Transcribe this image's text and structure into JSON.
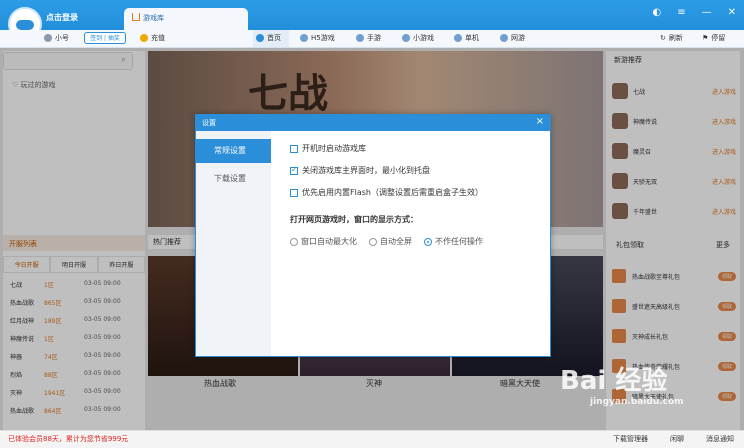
{
  "app": {
    "login": "点击登录",
    "tab": "游戏库"
  },
  "toolbar": {
    "user": "小号",
    "sign": "签到 | 抽奖",
    "recharge": "充值",
    "nav": [
      "首页",
      "H5游戏",
      "手游",
      "小游戏",
      "单机",
      "网游"
    ],
    "refresh": "刷新",
    "pin": "停留"
  },
  "left": {
    "played": "玩过的游戏",
    "open_title": "开服列表",
    "open_tabs": [
      "今日开服",
      "明日开服",
      "昨日开服"
    ],
    "rows": [
      {
        "n": "七战",
        "s": "1区",
        "t": "03-05 09:00"
      },
      {
        "n": "热血战歌",
        "s": "865区",
        "t": "03-05 09:00"
      },
      {
        "n": "红月战神",
        "s": "189区",
        "t": "03-05 09:00"
      },
      {
        "n": "神魔传说",
        "s": "1区",
        "t": "03-05 09:00"
      },
      {
        "n": "神器",
        "s": "74区",
        "t": "03-05 09:00"
      },
      {
        "n": "烈焰",
        "s": "88区",
        "t": "03-05 09:00"
      },
      {
        "n": "灭神",
        "s": "1941区",
        "t": "03-05 09:00"
      },
      {
        "n": "热血战歌",
        "s": "864区",
        "t": "03-05 09:00"
      }
    ]
  },
  "center": {
    "hot_title": "热门推荐",
    "captions": [
      "热血战歌",
      "灭神",
      "暗黑大天使"
    ]
  },
  "right": {
    "rec_title": "新游推荐",
    "recs": [
      {
        "nm": "七战",
        "btn": "进入游戏"
      },
      {
        "nm": "神魔传说",
        "btn": "进入游戏"
      },
      {
        "nm": "魔灵召",
        "btn": "进入游戏"
      },
      {
        "nm": "天骄无双",
        "btn": "进入游戏"
      },
      {
        "nm": "千年盛世",
        "btn": "进入游戏"
      }
    ],
    "gift_title": "礼包领取",
    "more": "更多",
    "gifts": [
      {
        "gn": "热血战歌至尊礼包",
        "gb": "领取"
      },
      {
        "gn": "盛世遮天高级礼包",
        "gb": "领取"
      },
      {
        "gn": "灭神成长礼包",
        "gb": "领取"
      },
      {
        "gn": "热血传奇荣耀礼包",
        "gb": "领取"
      },
      {
        "gn": "暗黑大天使礼包",
        "gb": "领取"
      }
    ]
  },
  "dialog": {
    "title": "设置",
    "side": [
      "常规设置",
      "下载设置"
    ],
    "options": [
      {
        "label": "开机时启动游戏库",
        "checked": false
      },
      {
        "label": "关闭游戏库主界面时，最小化到托盘",
        "checked": true
      },
      {
        "label": "优先启用内置Flash（调整设置后需重启盒子生效）",
        "checked": false
      }
    ],
    "section": "打开网页游戏时，窗口的显示方式：",
    "radios": [
      {
        "label": "窗口自动最大化",
        "on": false
      },
      {
        "label": "自动全屏",
        "on": false
      },
      {
        "label": "不作任何操作",
        "on": true
      }
    ]
  },
  "status": {
    "left": "已体验会员88天，累计为您节省999元",
    "right": [
      "下载管理器",
      "闲聊",
      "消息通知"
    ]
  },
  "watermark": {
    "brand": "Bai 经验",
    "url": "jingyan.baidu.com"
  }
}
